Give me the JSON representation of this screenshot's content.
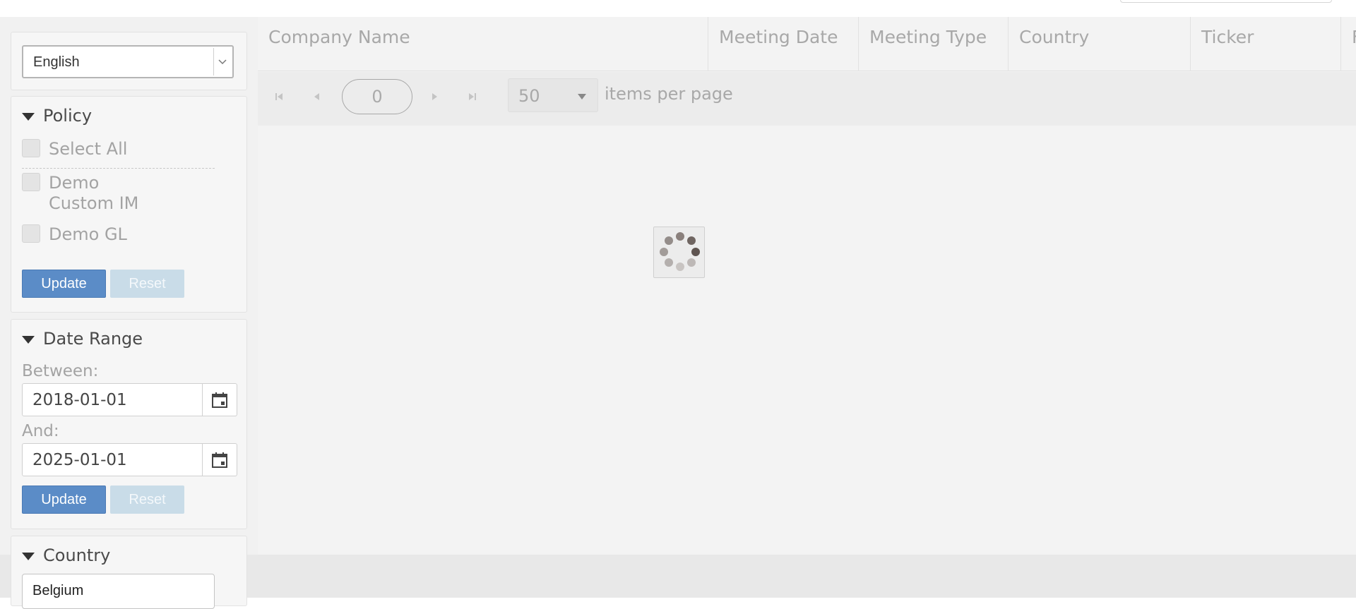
{
  "language": {
    "selected": "English"
  },
  "policy": {
    "title": "Policy",
    "select_all": "Select All",
    "options": [
      "Demo Custom IM",
      "Demo GL"
    ],
    "update_label": "Update",
    "reset_label": "Reset"
  },
  "date_range": {
    "title": "Date Range",
    "between_label": "Between:",
    "between_value": "2018-01-01",
    "and_label": "And:",
    "and_value": "2025-01-01",
    "update_label": "Update",
    "reset_label": "Reset"
  },
  "country": {
    "title": "Country",
    "value": "Belgium"
  },
  "grid": {
    "columns": [
      "Company Name",
      "Meeting Date",
      "Meeting Type",
      "Country",
      "Ticker",
      "F"
    ]
  },
  "pager": {
    "page": "0",
    "page_size": "50",
    "items_per_page_label": "items per page"
  },
  "colors": {
    "accent": "#5b8cc7",
    "reset_disabled": "#c9dce8"
  }
}
